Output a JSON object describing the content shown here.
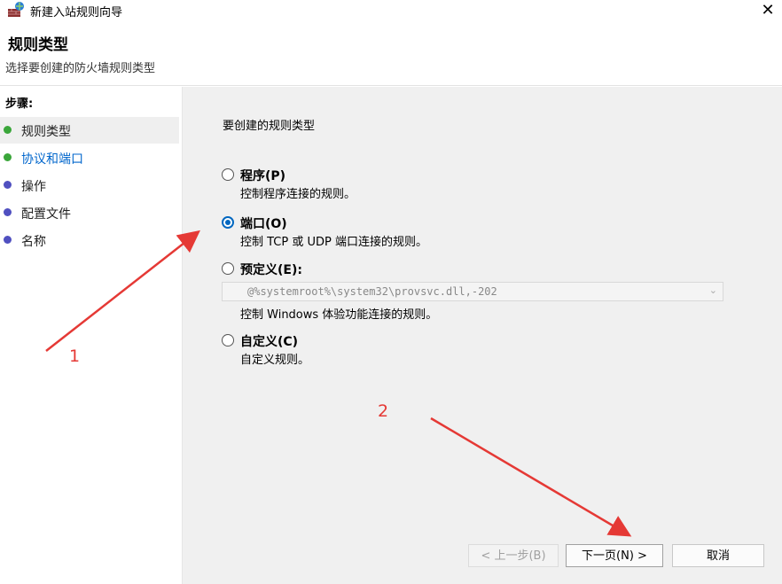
{
  "window": {
    "title": "新建入站规则向导",
    "close_icon": "✕"
  },
  "header": {
    "title": "规则类型",
    "subtitle": "选择要创建的防火墙规则类型"
  },
  "steps": {
    "title": "步骤:",
    "items": [
      {
        "label": "规则类型",
        "color": "#222222",
        "dot": "#3aa63a"
      },
      {
        "label": "协议和端口",
        "color": "#0066cc",
        "dot": "#3aa63a"
      },
      {
        "label": "操作",
        "color": "#222222",
        "dot": "#5050c0"
      },
      {
        "label": "配置文件",
        "color": "#222222",
        "dot": "#5050c0"
      },
      {
        "label": "名称",
        "color": "#222222",
        "dot": "#5050c0"
      }
    ]
  },
  "main": {
    "question": "要创建的规则类型",
    "options": [
      {
        "label": "程序(P)",
        "desc": "控制程序连接的规则。",
        "checked": false
      },
      {
        "label": "端口(O)",
        "desc": "控制 TCP 或 UDP 端口连接的规则。",
        "checked": true
      },
      {
        "label": "预定义(E):",
        "desc": "控制 Windows 体验功能连接的规则。",
        "checked": false
      },
      {
        "label": "自定义(C)",
        "desc": "自定义规则。",
        "checked": false
      }
    ],
    "predefined_value": "@%systemroot%\\system32\\provsvc.dll,-202"
  },
  "buttons": {
    "back": "< 上一步(B)",
    "next": "下一页(N) >",
    "cancel": "取消"
  },
  "annotations": {
    "one": "1",
    "two": "2",
    "arrow_color": "#e53935"
  }
}
